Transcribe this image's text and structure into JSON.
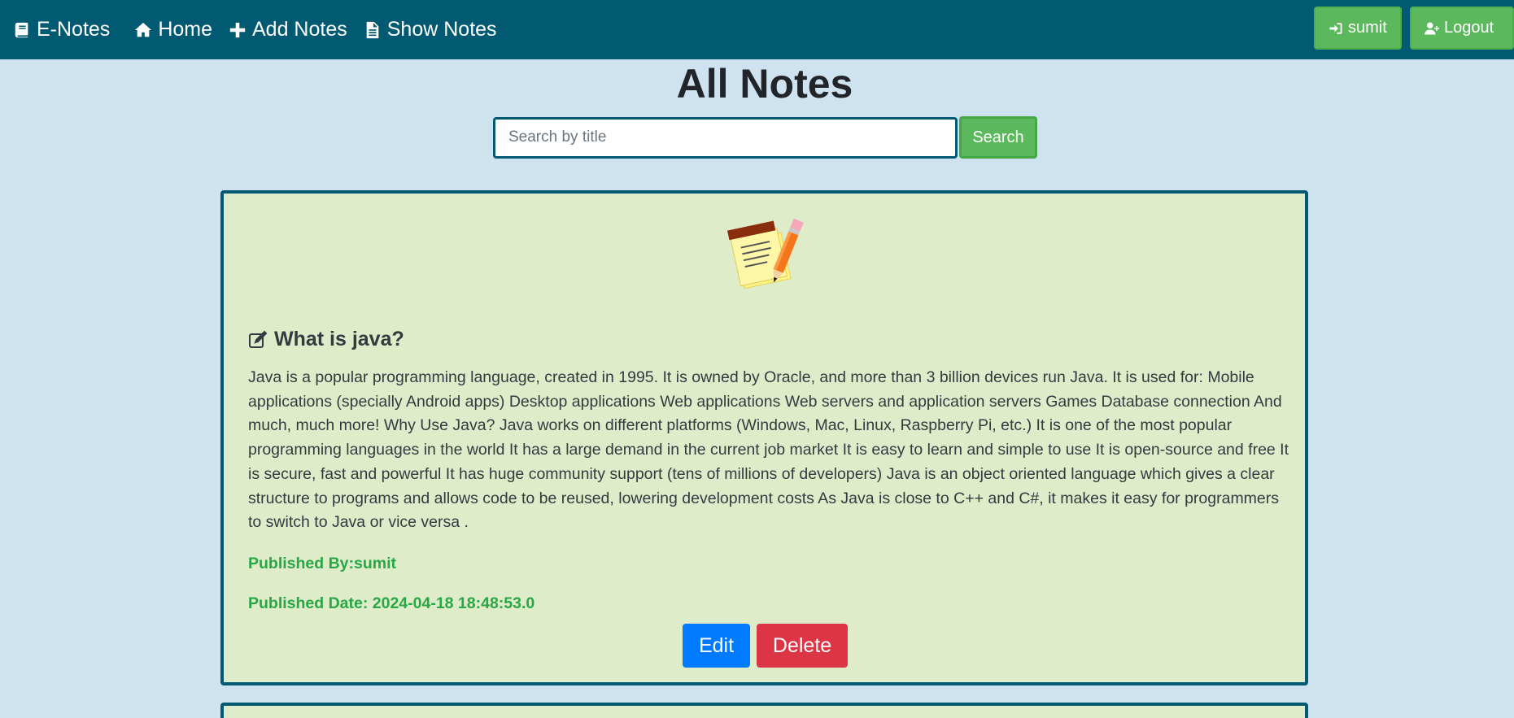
{
  "navbar": {
    "brand": "E-Notes",
    "links": [
      {
        "label": "Home",
        "icon": "home-icon"
      },
      {
        "label": "Add Notes",
        "icon": "plus-icon"
      },
      {
        "label": "Show Notes",
        "icon": "file-text-icon"
      }
    ],
    "user_label": "sumit",
    "logout_label": "Logout"
  },
  "page": {
    "title": "All Notes",
    "search_placeholder": "Search by title",
    "search_button": "Search"
  },
  "notes": [
    {
      "title": "What is java?",
      "content": "Java is a popular programming language, created in 1995. It is owned by Oracle, and more than 3 billion devices run Java. It is used for: Mobile applications (specially Android apps) Desktop applications Web applications Web servers and application servers Games Database connection And much, much more! Why Use Java? Java works on different platforms (Windows, Mac, Linux, Raspberry Pi, etc.) It is one of the most popular programming languages in the world It has a large demand in the current job market It is easy to learn and simple to use It is open-source and free It is secure, fast and powerful It has huge community support (tens of millions of developers) Java is an object oriented language which gives a clear structure to programs and allows code to be reused, lowering development costs As Java is close to C++ and C#, it makes it easy for programmers to switch to Java or vice versa .",
      "published_by": "Published By:sumit",
      "published_date": "Published Date: 2024-04-18 18:48:53.0",
      "edit_label": "Edit",
      "delete_label": "Delete"
    }
  ],
  "colors": {
    "navbar": "#015a72",
    "background": "#cfe2f0",
    "card": "#deecc9",
    "success": "#5cb85c",
    "primary": "#007bff",
    "danger": "#dc3545",
    "meta_text": "#28a745"
  }
}
